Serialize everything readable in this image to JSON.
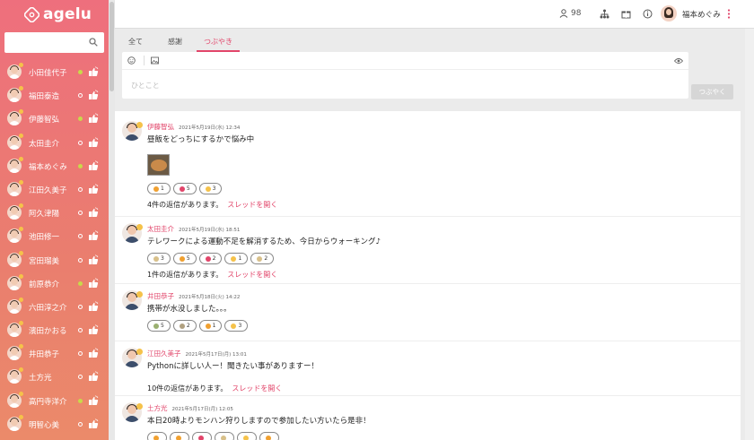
{
  "app": {
    "logo_text": "agelu"
  },
  "search": {
    "placeholder": ""
  },
  "sidebar": {
    "users": [
      {
        "name": "小田佳代子",
        "online": true
      },
      {
        "name": "福田泰造",
        "online": false
      },
      {
        "name": "伊藤智弘",
        "online": true
      },
      {
        "name": "太田圭介",
        "online": false
      },
      {
        "name": "福本めぐみ",
        "online": true
      },
      {
        "name": "江田久美子",
        "online": false
      },
      {
        "name": "阿久津陽",
        "online": false
      },
      {
        "name": "池田修一",
        "online": false
      },
      {
        "name": "宮田瑠美",
        "online": false
      },
      {
        "name": "前原恭介",
        "online": true
      },
      {
        "name": "六田淳之介",
        "online": false
      },
      {
        "name": "濱田かおる",
        "online": false
      },
      {
        "name": "井田恭子",
        "online": false
      },
      {
        "name": "土方光",
        "online": false
      },
      {
        "name": "高円寺洋介",
        "online": true
      },
      {
        "name": "明智心美",
        "online": false
      }
    ]
  },
  "topbar": {
    "online_count": "98",
    "user_name": "福本めぐみ"
  },
  "tabs": [
    {
      "label": "全て",
      "active": false
    },
    {
      "label": "感謝",
      "active": false
    },
    {
      "label": "つぶやき",
      "active": true
    }
  ],
  "compose": {
    "placeholder": "ひとこと",
    "post_button": "つぶやく"
  },
  "posts": [
    {
      "author": "伊藤智弘",
      "date": "2021年5月19日(水) 12:34",
      "body": "昼飯をどっちにするかで悩み中",
      "has_image": true,
      "reactions": [
        {
          "count": "1",
          "color": "#f0a030"
        },
        {
          "count": "5",
          "color": "#e2456a"
        },
        {
          "count": "3",
          "color": "#f5c24a"
        }
      ],
      "replies": "4件の返信があります。",
      "thread_link": "スレッドを開く"
    },
    {
      "author": "太田圭介",
      "date": "2021年5月19日(水) 18:51",
      "body": "テレワークによる運動不足を解消するため、今日からウォーキング♪",
      "has_image": false,
      "reactions": [
        {
          "count": "3",
          "color": "#d8c08a"
        },
        {
          "count": "5",
          "color": "#f0a030"
        },
        {
          "count": "2",
          "color": "#e2456a"
        },
        {
          "count": "1",
          "color": "#f5c24a"
        },
        {
          "count": "2",
          "color": "#d8c08a"
        }
      ],
      "replies": "1件の返信があります。",
      "thread_link": "スレッドを開く"
    },
    {
      "author": "井田恭子",
      "date": "2021年5月18日(火) 14:22",
      "body": "携帯が水没しました。。。",
      "has_image": false,
      "reactions": [
        {
          "count": "5",
          "color": "#9ab070"
        },
        {
          "count": "2",
          "color": "#b0a080"
        },
        {
          "count": "1",
          "color": "#f0a030"
        },
        {
          "count": "3",
          "color": "#f5c24a"
        }
      ],
      "replies": "",
      "thread_link": ""
    },
    {
      "author": "江田久美子",
      "date": "2021年5月17日(月) 13:01",
      "body": "Pythonに詳しい人ー！聞きたい事がありますー！",
      "has_image": false,
      "reactions": [],
      "replies": "10件の返信があります。",
      "thread_link": "スレッドを開く"
    },
    {
      "author": "土方光",
      "date": "2021年5月17日(月) 12:05",
      "body": "本日20時よりモンハン狩りしますので参加したい方いたら是非！",
      "has_image": false,
      "reactions": [
        {
          "count": "",
          "color": "#f0a030"
        },
        {
          "count": "",
          "color": "#f0a030"
        },
        {
          "count": "",
          "color": "#e2456a"
        },
        {
          "count": "",
          "color": "#d8c08a"
        },
        {
          "count": "",
          "color": "#f5c24a"
        },
        {
          "count": "",
          "color": "#f0a030"
        }
      ],
      "replies": "",
      "thread_link": ""
    }
  ],
  "colors": {
    "accent": "#e2456a",
    "online": "#c9d94a"
  }
}
